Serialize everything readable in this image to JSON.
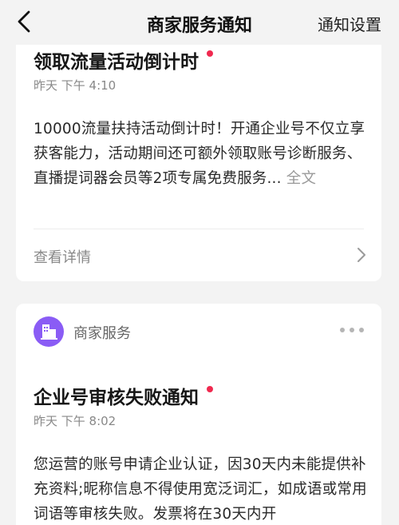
{
  "navbar": {
    "title": "商家服务通知",
    "right_action": "通知设置"
  },
  "messages": [
    {
      "title": "领取流量活动倒计时",
      "time": "昨天 下午 4:10",
      "body": "10000流量扶持活动倒计时！开通企业号不仅立享获客能力，活动期间还可额外领取账号诊断服务、直播提词器会员等2项专属免费服务... ",
      "more_label": "全文",
      "detail_label": "查看详情"
    },
    {
      "sender": "商家服务",
      "title": "企业号审核失败通知",
      "time": "昨天 下午 8:02",
      "body": "您运营的账号申请企业认证，因30天内未能提供补充资料;昵称信息不得使用宽泛词汇，如成语或常用词语等审核失败。发票将在30天内开"
    }
  ],
  "colors": {
    "unread_dot": "#f0294f",
    "avatar_bg": "#8a5cf5",
    "page_bg": "#f3f3f3"
  },
  "icons": {
    "back": "chevron-left-icon",
    "detail": "chevron-right-icon",
    "avatar": "shop-building-icon",
    "more": "more-dots-icon"
  }
}
